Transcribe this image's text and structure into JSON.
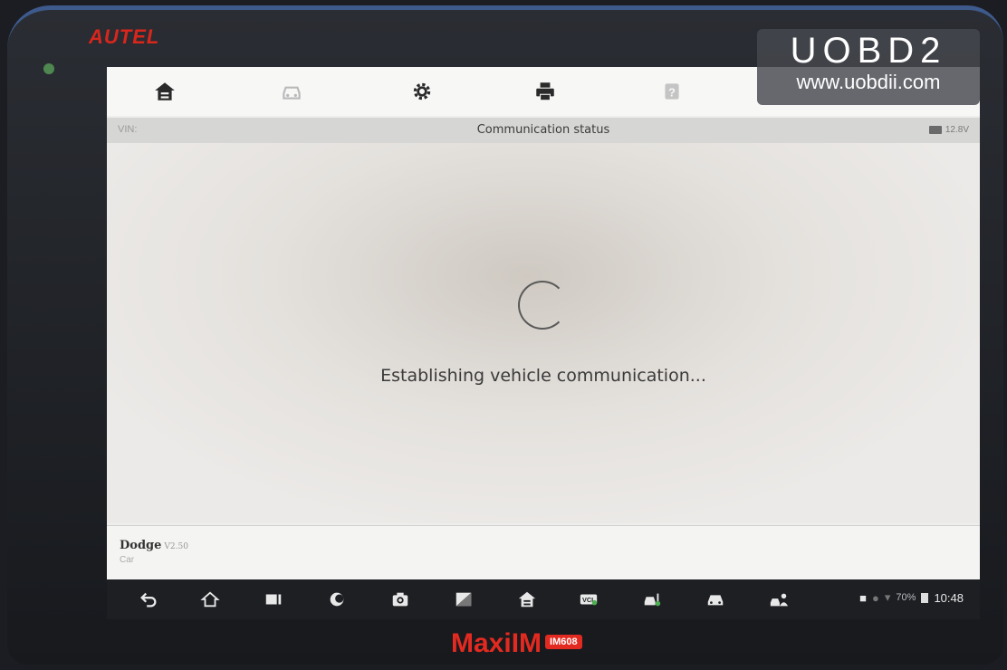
{
  "device": {
    "brand": "AUTEL",
    "model": "MaxiIM",
    "model_badge": "IM608"
  },
  "watermark": {
    "title": "UOBD2",
    "url": "www.uobdii.com"
  },
  "toolbar": {
    "items": [
      {
        "icon": "home-icon"
      },
      {
        "icon": "vehicle-icon"
      },
      {
        "icon": "settings-gear-icon"
      },
      {
        "icon": "print-icon"
      },
      {
        "icon": "help-icon"
      }
    ]
  },
  "status_bar": {
    "vin_label": "VIN:",
    "title": "Communication status",
    "voltage": "12.8V"
  },
  "main": {
    "message": "Establishing vehicle communication..."
  },
  "footer": {
    "make": "Dodge",
    "version": "V2.50",
    "vehicle_type": "Car"
  },
  "system_bar": {
    "battery_percent": "70%",
    "time": "10:48"
  },
  "colors": {
    "brand_red": "#e32a20",
    "device_trim": "#3e5a8c",
    "screen_bg": "#eeeeed"
  }
}
